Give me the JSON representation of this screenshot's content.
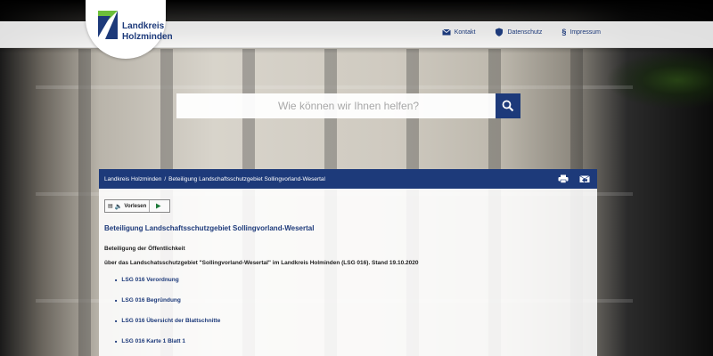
{
  "logo": {
    "line1": "Landkreis",
    "line2": "Holzminden"
  },
  "nav": [
    {
      "label": "Kontakt",
      "icon": "mail-icon"
    },
    {
      "label": "Datenschutz",
      "icon": "shield-icon"
    },
    {
      "label": "Impressum",
      "icon": "section-icon"
    }
  ],
  "search": {
    "placeholder": "Wie können wir Ihnen helfen?"
  },
  "breadcrumb": {
    "home": "Landkreis Holzminden",
    "sep": "/",
    "current": "Beteiligung Landschaftsschutzgebiet Sollingvorland-Wesertal"
  },
  "tools": {
    "print": "print-icon",
    "share": "share-icon"
  },
  "reader": {
    "label": "Vorlesen"
  },
  "page": {
    "title": "Beteiligung Landschaftsschutzgebiet Sollingvorland-Wesertal",
    "line1": "Beteiligung der Öffentlichkeit",
    "line2": "über das Landschatsschutzgebiet \"Sollingvorland-Wesertal\" im Landkreis Holminden (LSG 016). Stand 19.10.2020"
  },
  "links": [
    "LSG 016 Verordnung",
    "LSG 016 Begründung",
    "LSG 016 Übersicht der Blattschnitte",
    "LSG 016 Karte 1 Blatt 1"
  ],
  "colors": {
    "brand": "#1d3a7a",
    "logo_green": "#6cbf3a"
  }
}
